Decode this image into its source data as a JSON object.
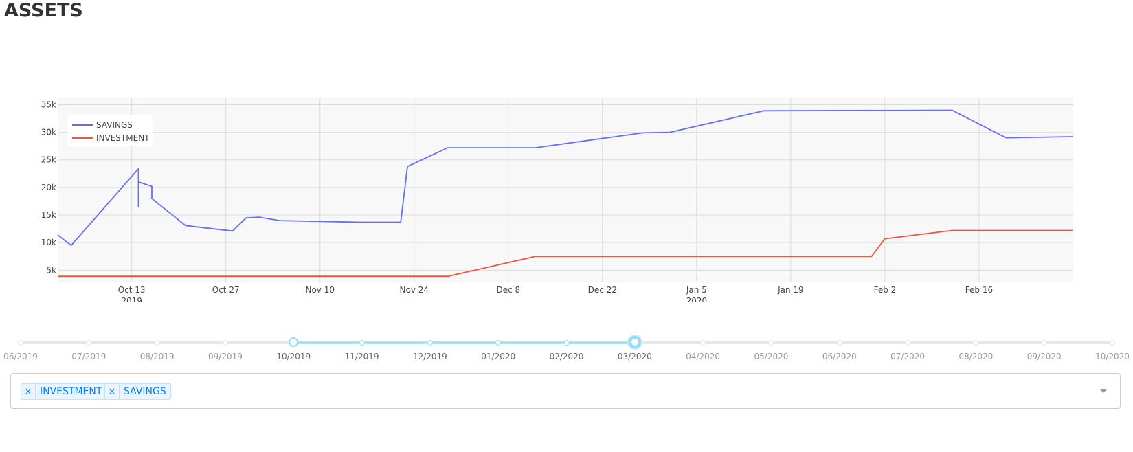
{
  "page": {
    "title": "ASSETS"
  },
  "chart_data": {
    "type": "line",
    "x_type": "date",
    "xlim": [
      "2019-10-02",
      "2020-03-01"
    ],
    "ylim": [
      2800,
      36300
    ],
    "grid": true,
    "plot_background": "#f8f8f8",
    "legend_position": "top-left",
    "x_ticks": [
      {
        "date": "2019-10-13",
        "label": "Oct 13",
        "sublabel": "2019"
      },
      {
        "date": "2019-10-27",
        "label": "Oct 27",
        "sublabel": ""
      },
      {
        "date": "2019-11-10",
        "label": "Nov 10",
        "sublabel": ""
      },
      {
        "date": "2019-11-24",
        "label": "Nov 24",
        "sublabel": ""
      },
      {
        "date": "2019-12-08",
        "label": "Dec 8",
        "sublabel": ""
      },
      {
        "date": "2019-12-22",
        "label": "Dec 22",
        "sublabel": ""
      },
      {
        "date": "2020-01-05",
        "label": "Jan 5",
        "sublabel": "2020"
      },
      {
        "date": "2020-01-19",
        "label": "Jan 19",
        "sublabel": ""
      },
      {
        "date": "2020-02-02",
        "label": "Feb 2",
        "sublabel": ""
      },
      {
        "date": "2020-02-16",
        "label": "Feb 16",
        "sublabel": ""
      }
    ],
    "y_ticks": [
      {
        "value": 5000,
        "label": "5k"
      },
      {
        "value": 10000,
        "label": "10k"
      },
      {
        "value": 15000,
        "label": "15k"
      },
      {
        "value": 20000,
        "label": "20k"
      },
      {
        "value": 25000,
        "label": "25k"
      },
      {
        "value": 30000,
        "label": "30k"
      },
      {
        "value": 35000,
        "label": "35k"
      }
    ],
    "series": [
      {
        "name": "SAVINGS",
        "color": "#636efa",
        "points": [
          [
            "2019-10-02",
            11400
          ],
          [
            "2019-10-04",
            9500
          ],
          [
            "2019-10-14",
            23400
          ],
          [
            "2019-10-14",
            16500
          ],
          [
            "2019-10-14",
            21000
          ],
          [
            "2019-10-16",
            20200
          ],
          [
            "2019-10-16",
            18000
          ],
          [
            "2019-10-21",
            13100
          ],
          [
            "2019-10-28",
            12100
          ],
          [
            "2019-10-30",
            14500
          ],
          [
            "2019-11-01",
            14600
          ],
          [
            "2019-11-04",
            14000
          ],
          [
            "2019-11-16",
            13700
          ],
          [
            "2019-11-22",
            13700
          ],
          [
            "2019-11-23",
            23800
          ],
          [
            "2019-11-29",
            27200
          ],
          [
            "2019-12-12",
            27200
          ],
          [
            "2019-12-28",
            29900
          ],
          [
            "2020-01-01",
            30000
          ],
          [
            "2020-01-15",
            33900
          ],
          [
            "2020-02-12",
            34000
          ],
          [
            "2020-02-20",
            29000
          ],
          [
            "2020-03-01",
            29200
          ]
        ]
      },
      {
        "name": "INVESTMENT",
        "color": "#ef553b",
        "points": [
          [
            "2019-10-02",
            3900
          ],
          [
            "2019-11-29",
            3900
          ],
          [
            "2019-12-12",
            7500
          ],
          [
            "2020-01-31",
            7500
          ],
          [
            "2020-02-02",
            10700
          ],
          [
            "2020-02-12",
            12200
          ],
          [
            "2020-03-01",
            12200
          ]
        ]
      }
    ]
  },
  "slider": {
    "marks": [
      "06/2019",
      "07/2019",
      "08/2019",
      "09/2019",
      "10/2019",
      "11/2019",
      "12/2019",
      "01/2020",
      "02/2020",
      "03/2020",
      "04/2020",
      "05/2020",
      "06/2020",
      "07/2020",
      "08/2020",
      "09/2020",
      "10/2020"
    ],
    "start_index": 4,
    "end_index": 9,
    "track_color": "#abe2fb"
  },
  "selector": {
    "tags": [
      {
        "remove": "×",
        "label": "INVESTMENT"
      },
      {
        "remove": "×",
        "label": "SAVINGS"
      }
    ]
  }
}
